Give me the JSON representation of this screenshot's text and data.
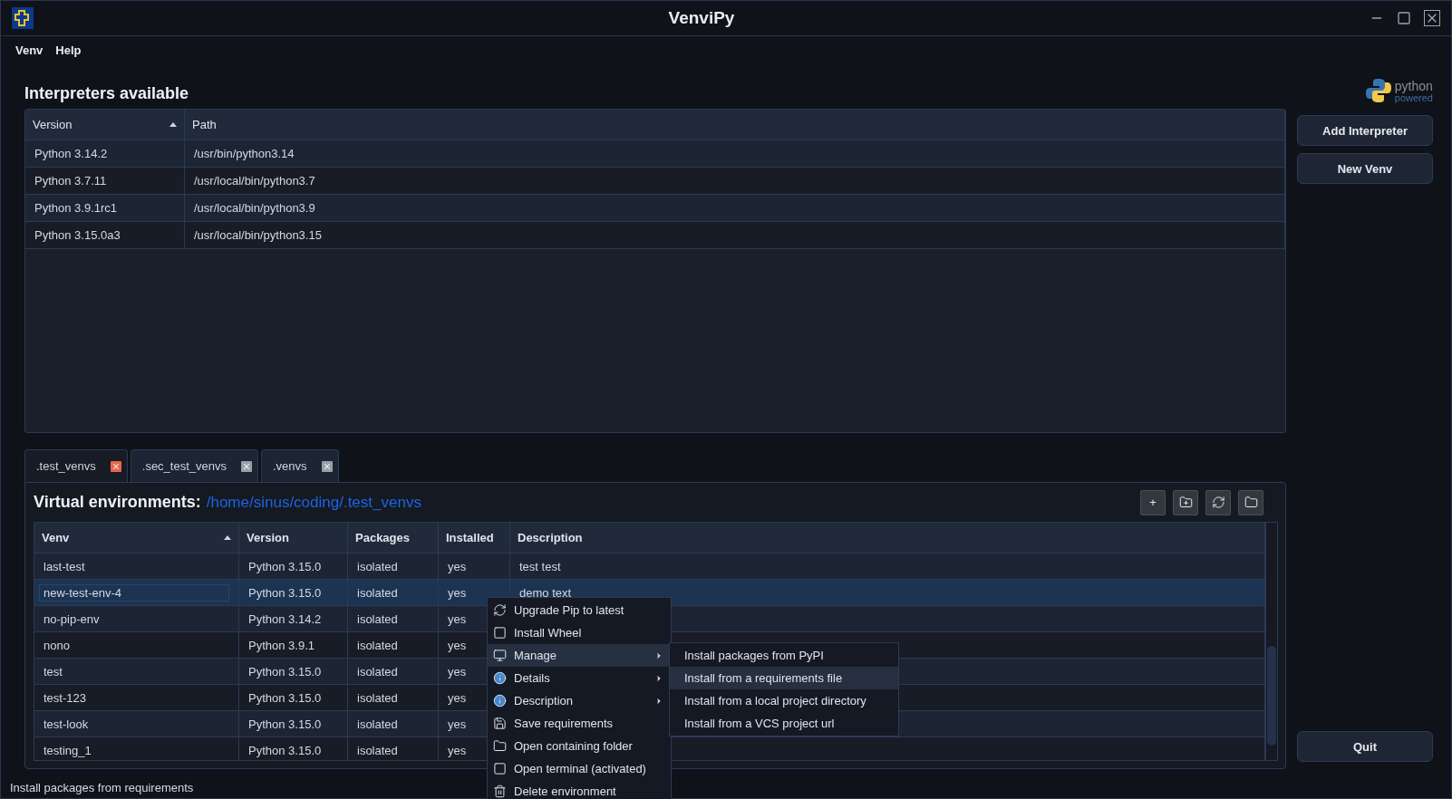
{
  "window": {
    "title": "VenviPy"
  },
  "menubar": [
    {
      "label": "Venv"
    },
    {
      "label": "Help"
    }
  ],
  "logo": {
    "word": "python",
    "tagline": "powered"
  },
  "interpreters": {
    "title": "Interpreters available",
    "columns": [
      {
        "label": "Version",
        "sorted": true
      },
      {
        "label": "Path",
        "sorted": false
      }
    ],
    "rows": [
      [
        "Python 3.14.2",
        "/usr/bin/python3.14"
      ],
      [
        "Python 3.7.11",
        "/usr/local/bin/python3.7"
      ],
      [
        "Python 3.9.1rc1",
        "/usr/local/bin/python3.9"
      ],
      [
        "Python 3.15.0a3",
        "/usr/local/bin/python3.15"
      ]
    ]
  },
  "side_buttons": [
    {
      "label": "Add Interpreter"
    },
    {
      "label": "New Venv"
    }
  ],
  "quit_button": "Quit",
  "tabs": [
    {
      "label": ".test_venvs",
      "selected": true
    },
    {
      "label": ".sec_test_venvs",
      "selected": false
    },
    {
      "label": ".venvs",
      "selected": false
    }
  ],
  "venvs": {
    "title": "Virtual environments:",
    "path": "/home/sinus/coding/.test_venvs",
    "toolbar": [
      {
        "kind": "text",
        "label": "+"
      },
      {
        "kind": "new-folder"
      },
      {
        "kind": "refresh"
      },
      {
        "kind": "folder"
      }
    ],
    "columns": [
      {
        "label": "Venv",
        "sorted": true
      },
      {
        "label": "Version",
        "sorted": false
      },
      {
        "label": "Packages",
        "sorted": false
      },
      {
        "label": "Installed",
        "sorted": false
      },
      {
        "label": "Description",
        "sorted": false
      }
    ],
    "rows": [
      {
        "cells": [
          "last-test",
          "Python 3.15.0",
          "isolated",
          "yes",
          "test test"
        ],
        "selected": false
      },
      {
        "cells": [
          "new-test-env-4",
          "Python 3.15.0",
          "isolated",
          "yes",
          "demo text"
        ],
        "selected": true
      },
      {
        "cells": [
          "no-pip-env",
          "Python 3.14.2",
          "isolated",
          "yes",
          ""
        ],
        "selected": false
      },
      {
        "cells": [
          "nono",
          "Python 3.9.1",
          "isolated",
          "yes",
          ""
        ],
        "selected": false
      },
      {
        "cells": [
          "test",
          "Python 3.15.0",
          "isolated",
          "yes",
          ""
        ],
        "selected": false
      },
      {
        "cells": [
          "test-123",
          "Python 3.15.0",
          "isolated",
          "yes",
          ""
        ],
        "selected": false
      },
      {
        "cells": [
          "test-look",
          "Python 3.15.0",
          "isolated",
          "yes",
          ""
        ],
        "selected": false
      },
      {
        "cells": [
          "testing_1",
          "Python 3.15.0",
          "isolated",
          "yes",
          ""
        ],
        "selected": false
      }
    ]
  },
  "context_menu": [
    {
      "label": "Upgrade Pip to latest",
      "kind": "refresh",
      "submenu": false,
      "selected": false
    },
    {
      "label": "Install Wheel",
      "kind": "window",
      "submenu": false,
      "selected": false
    },
    {
      "label": "Manage",
      "kind": "monitor",
      "submenu": true,
      "selected": true
    },
    {
      "label": "Details",
      "kind": "info",
      "submenu": true,
      "selected": false
    },
    {
      "label": "Description",
      "kind": "info",
      "submenu": true,
      "selected": false
    },
    {
      "label": "Save requirements",
      "kind": "save",
      "submenu": false,
      "selected": false
    },
    {
      "label": "Open containing folder",
      "kind": "folder",
      "submenu": false,
      "selected": false
    },
    {
      "label": "Open terminal (activated)",
      "kind": "window",
      "submenu": false,
      "selected": false
    },
    {
      "label": "Delete environment",
      "kind": "trash",
      "submenu": false,
      "selected": false
    }
  ],
  "submenu": [
    {
      "label": "Install packages from PyPI",
      "selected": false
    },
    {
      "label": "Install from a requirements file",
      "selected": true
    },
    {
      "label": "Install from a local project directory",
      "selected": false
    },
    {
      "label": "Install from a VCS project url",
      "selected": false
    }
  ],
  "status_bar": "Install packages from requirements"
}
